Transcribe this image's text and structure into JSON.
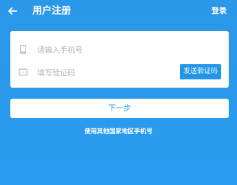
{
  "header": {
    "back_icon": "arrow-left-icon",
    "title": "用户注册",
    "login_label": "登录"
  },
  "form": {
    "phone_icon": "phone-icon",
    "phone_placeholder": "请输入手机号",
    "phone_value": "",
    "code_icon": "sms-code-icon",
    "code_placeholder": "填写验证码",
    "code_value": "",
    "send_code_label": "发送验证码"
  },
  "next_label": "下一步",
  "other_region_label": "使用其他国家地区手机号",
  "colors": {
    "background": "#2b97e8",
    "accent": "#2196ea",
    "card": "#ffffff",
    "placeholder": "#b4b4b4"
  }
}
